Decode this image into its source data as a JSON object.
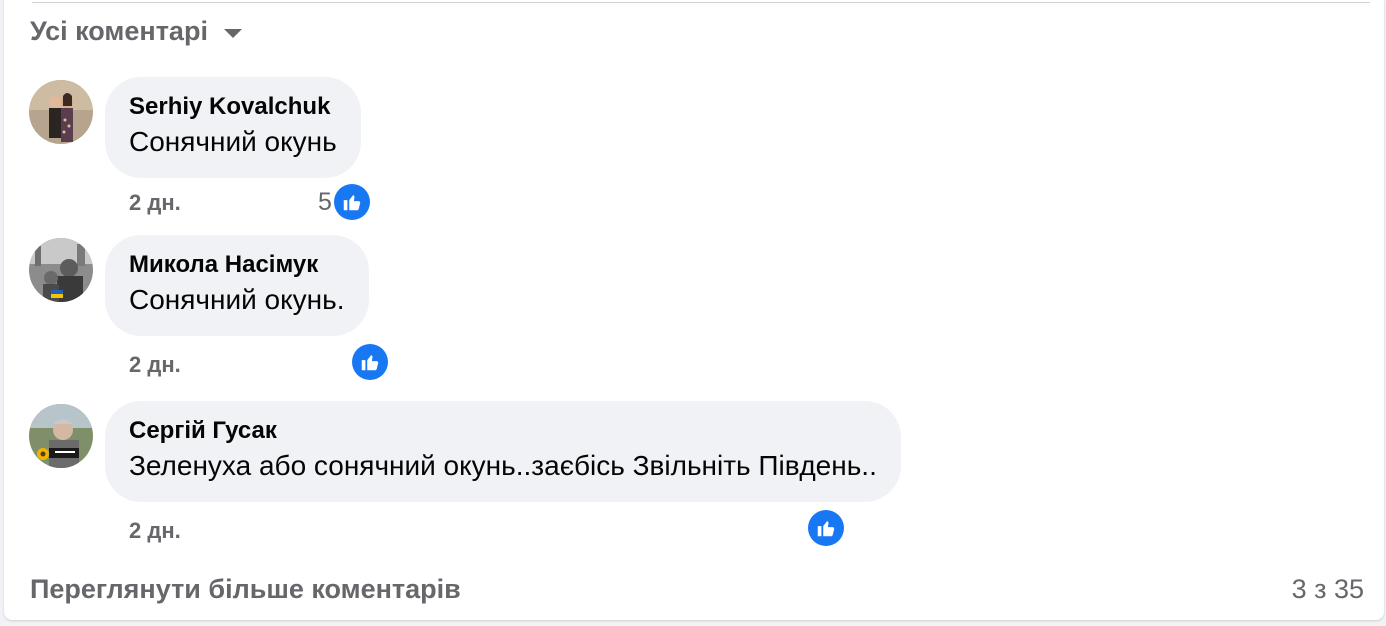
{
  "filter": {
    "label": "Усі коментарі",
    "icon": "caret-down-icon"
  },
  "comments": [
    {
      "author": "Serhiy Kovalchuk",
      "text": "Сонячний окунь",
      "time": "2 дн.",
      "likes": "5",
      "reaction_icon": "thumbs-up-icon"
    },
    {
      "author": "Микола Насімук",
      "text": "Сонячний окунь.",
      "time": "2 дн.",
      "likes": "",
      "reaction_icon": "thumbs-up-icon"
    },
    {
      "author": "Сергій Гусак",
      "text": "Зеленуха або сонячний окунь..заєбісь Звільніть Південь..",
      "time": "2 дн.",
      "likes": "",
      "reaction_icon": "thumbs-up-icon"
    }
  ],
  "footer": {
    "more_label": "Переглянути більше коментарів",
    "counter": "3 з 35"
  },
  "colors": {
    "like_blue": "#1877f2",
    "secondary_text": "#65676b",
    "bubble_bg": "#f0f2f5"
  }
}
